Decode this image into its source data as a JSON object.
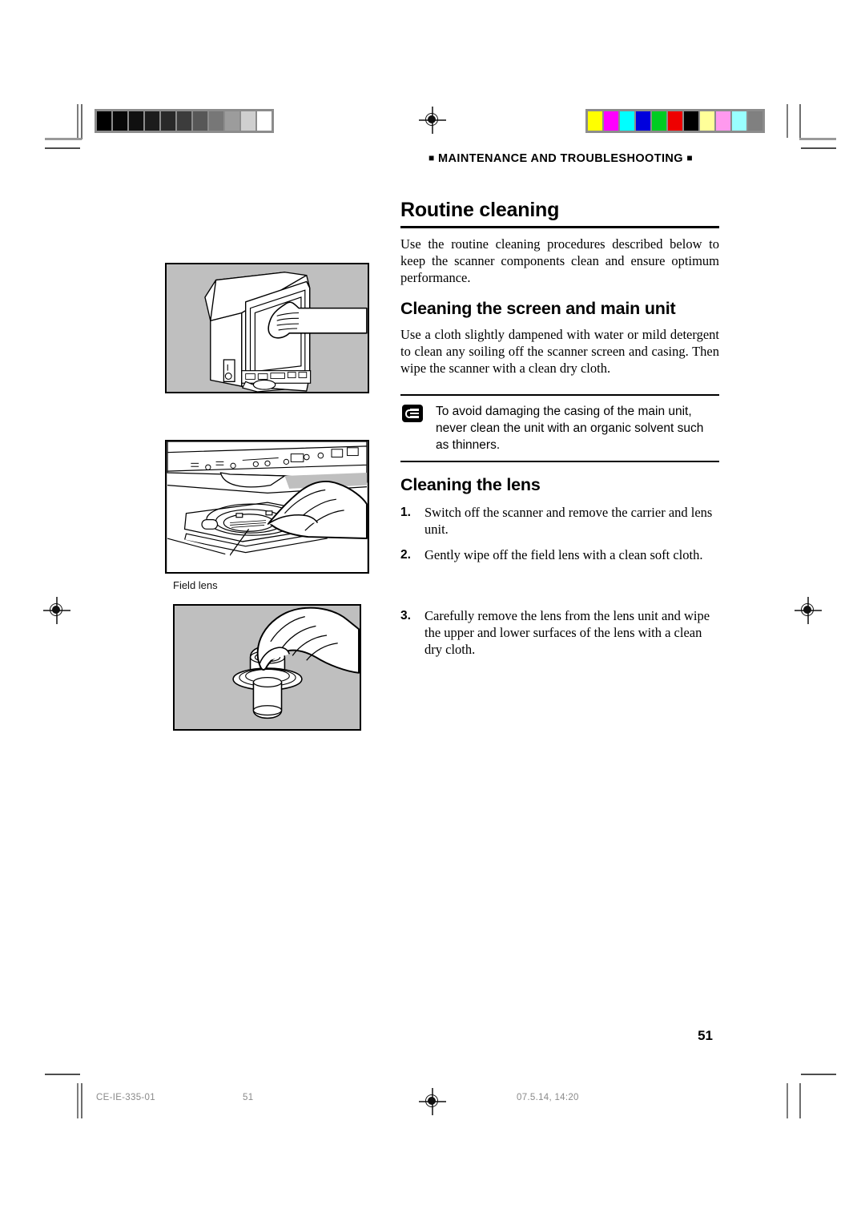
{
  "document": {
    "running_head": "MAINTENANCE AND TROUBLESHOOTING",
    "marker_square": "■",
    "page_number": "51"
  },
  "sections": {
    "main_title": "Routine cleaning",
    "intro": "Use the routine cleaning procedures described below to keep the scanner components clean and ensure optimum performance.",
    "sub1_title": "Cleaning the screen and main unit",
    "sub1_body": "Use a cloth slightly dampened with water or mild detergent to clean any soiling off the scanner screen and casing. Then wipe the scanner with a clean dry cloth.",
    "sub2_title": "Cleaning the lens"
  },
  "note": {
    "icon": "note-hand-icon",
    "text": "To avoid damaging the casing of the main unit, never clean the unit with an organic solvent such as thinners."
  },
  "steps": [
    {
      "num": "1.",
      "text": "Switch off the scanner and remove the carrier and lens unit."
    },
    {
      "num": "2.",
      "text": "Gently wipe off the field lens with a clean soft cloth."
    },
    {
      "num": "3.",
      "text": "Carefully remove the lens from the lens unit and wipe the upper and lower surfaces of the lens with a clean dry cloth."
    }
  ],
  "figures": {
    "fig1_alt": "Hand wiping the scanner screen with a cloth",
    "fig2_alt": "Hand wiping the field lens inside the scanner",
    "fig2_caption": "Field lens",
    "fig3_alt": "Hand removing the lens from the lens unit"
  },
  "print_marks": {
    "grayscale_steps": [
      "#000000",
      "#070707",
      "#101010",
      "#1c1c1c",
      "#292929",
      "#3c3c3c",
      "#575757",
      "#777777",
      "#9c9c9c",
      "#cfcfcf",
      "#ffffff"
    ],
    "color_steps": [
      "#ffff00",
      "#ff00ff",
      "#00ffff",
      "#0000dd",
      "#00cc22",
      "#ee0000",
      "#000000",
      "#ffff99",
      "#ff99ee",
      "#99ffff",
      "#808080"
    ]
  },
  "footer": {
    "doc_code": "CE-IE-335-01",
    "page_label": "51",
    "timestamp": "07.5.14, 14:20"
  }
}
